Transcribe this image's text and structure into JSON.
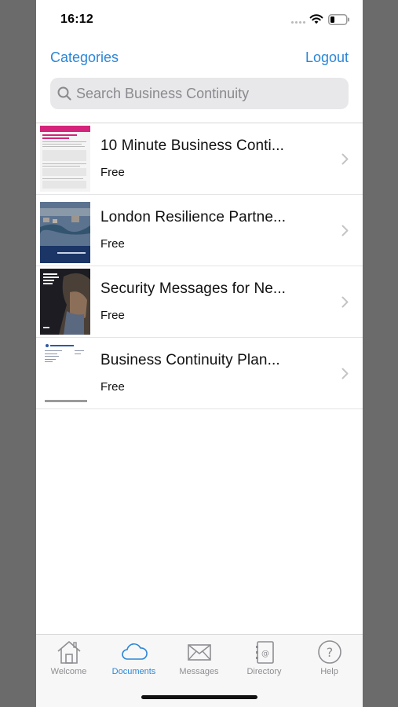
{
  "status_bar": {
    "time": "16:12"
  },
  "nav": {
    "left_label": "Categories",
    "right_label": "Logout"
  },
  "search": {
    "placeholder": "Search Business Continuity",
    "value": ""
  },
  "documents": [
    {
      "title": "10 Minute Business Conti...",
      "price": "Free",
      "thumbnail": "pink-header-report"
    },
    {
      "title": "London Resilience Partne...",
      "price": "Free",
      "thumbnail": "london-aerial-cover"
    },
    {
      "title": "Security Messages for Ne...",
      "price": "Free",
      "thumbnail": "dark-security-cover"
    },
    {
      "title": "Business Continuity Plan...",
      "price": "Free",
      "thumbnail": "white-form-document"
    }
  ],
  "tab_bar": {
    "tabs": [
      {
        "label": "Welcome",
        "icon": "house-icon",
        "active": false
      },
      {
        "label": "Documents",
        "icon": "cloud-icon",
        "active": true
      },
      {
        "label": "Messages",
        "icon": "envelope-icon",
        "active": false
      },
      {
        "label": "Directory",
        "icon": "address-book-icon",
        "active": false
      },
      {
        "label": "Help",
        "icon": "question-circle-icon",
        "active": false
      }
    ]
  },
  "colors": {
    "accent": "#2b86d8",
    "inactive": "#8e8e93",
    "background": "#ffffff",
    "outer_background": "#6b6b6b"
  }
}
